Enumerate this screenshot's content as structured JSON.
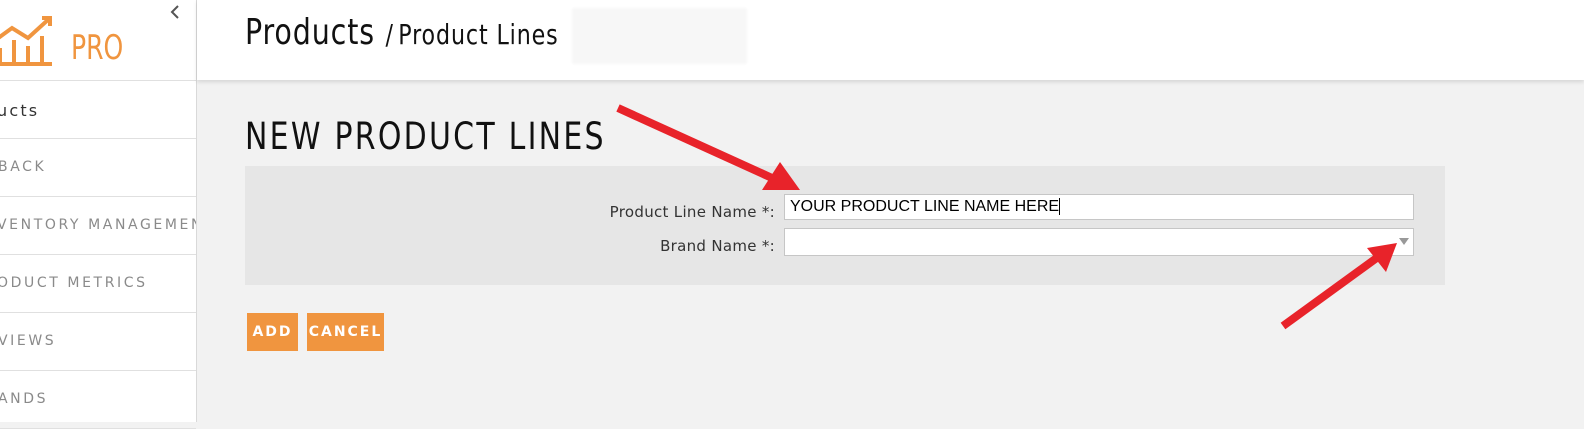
{
  "logo": {
    "text": "PRO"
  },
  "sidebar": {
    "items": [
      {
        "label": "ucts",
        "active": true
      },
      {
        "label": "BACK"
      },
      {
        "label": "VENTORY MANAGEMENT"
      },
      {
        "label": "ODUCT METRICS"
      },
      {
        "label": "VIEWS"
      },
      {
        "label": "ANDS"
      }
    ]
  },
  "header": {
    "crumb_root": "Products",
    "crumb_sep": "/",
    "crumb_current": "Product Lines"
  },
  "main": {
    "title": "NEW PRODUCT LINES",
    "form": {
      "product_line_label": "Product Line Name *:",
      "product_line_value": "YOUR PRODUCT LINE NAME HERE",
      "brand_label": "Brand Name *:",
      "brand_value": ""
    },
    "buttons": {
      "add": "ADD",
      "cancel": "CANCEL"
    }
  },
  "colors": {
    "accent": "#f0953f",
    "annotation_arrow": "#e8232a",
    "page_bg": "#f2f2f2",
    "panel_bg": "#e6e6e6"
  },
  "icons": {
    "logo": "chart-logo-icon",
    "collapse": "chevron-left-icon",
    "dropdown": "caret-down-icon"
  }
}
